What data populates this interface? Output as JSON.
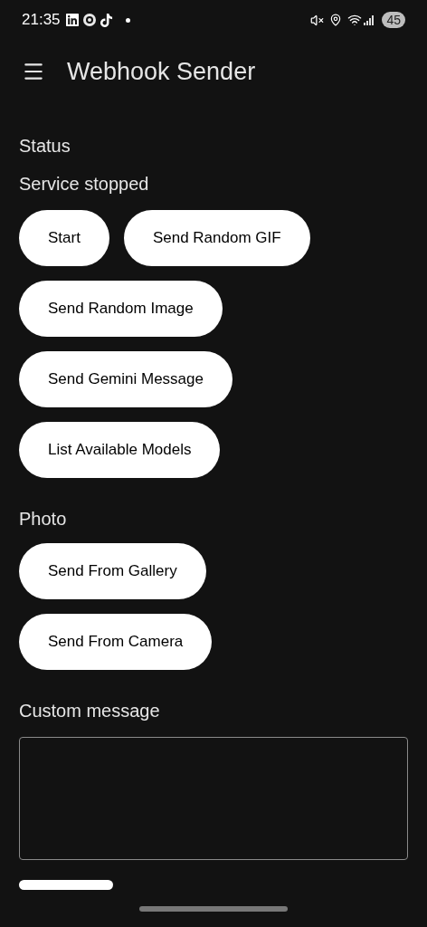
{
  "status_bar": {
    "time": "21:35",
    "battery": "45"
  },
  "app_bar": {
    "title": "Webhook Sender"
  },
  "content": [
    {
      "kind": "heading",
      "text": "Status"
    },
    {
      "kind": "text",
      "text": "Service stopped"
    },
    {
      "kind": "buttons",
      "buttons": [
        "Start",
        "Send Random GIF"
      ]
    },
    {
      "kind": "buttons",
      "buttons": [
        "Send Random Image"
      ]
    },
    {
      "kind": "buttons",
      "buttons": [
        "Send Gemini Message"
      ]
    },
    {
      "kind": "buttons",
      "buttons": [
        "List Available Models"
      ]
    },
    {
      "kind": "heading",
      "text": "Photo"
    },
    {
      "kind": "buttons",
      "buttons": [
        "Send From Gallery"
      ]
    },
    {
      "kind": "buttons",
      "buttons": [
        "Send From Camera"
      ]
    },
    {
      "kind": "heading",
      "text": "Custom message"
    },
    {
      "kind": "textarea"
    },
    {
      "kind": "partial_button"
    }
  ]
}
